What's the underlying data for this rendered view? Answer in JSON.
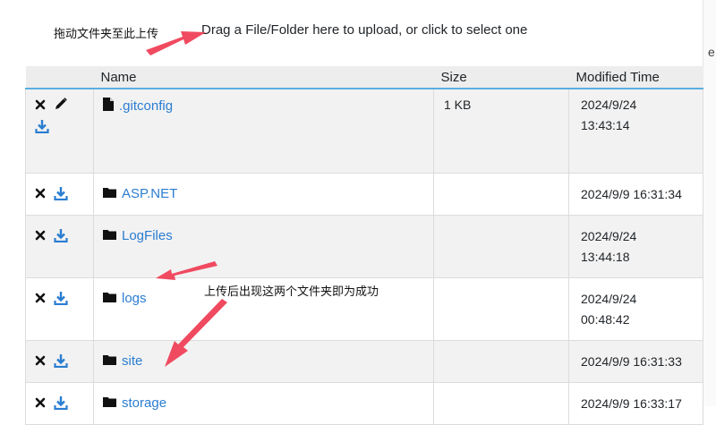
{
  "annotations": {
    "drag_hint_cn": "拖动文件夹至此上传",
    "result_hint_cn": "上传后出现这两个文件夹即为成功"
  },
  "upload_hint": "Drag a File/Folder here to upload, or click to select one",
  "side_letter": "e",
  "table": {
    "headers": {
      "name": "Name",
      "size": "Size",
      "modified": "Modified Time"
    },
    "rows": [
      {
        "type": "file",
        "name": ".gitconfig",
        "size": "1 KB",
        "modified_date": "2024/9/24",
        "modified_time": "13:43:14",
        "editable": true
      },
      {
        "type": "folder",
        "name": "ASP.NET",
        "size": "",
        "modified_date": "2024/9/9 16:31:34",
        "modified_time": "",
        "editable": false
      },
      {
        "type": "folder",
        "name": "LogFiles",
        "size": "",
        "modified_date": "2024/9/24",
        "modified_time": "13:44:18",
        "editable": false
      },
      {
        "type": "folder",
        "name": "logs",
        "size": "",
        "modified_date": "2024/9/24",
        "modified_time": "00:48:42",
        "editable": false
      },
      {
        "type": "folder",
        "name": "site",
        "size": "",
        "modified_date": "2024/9/9 16:31:33",
        "modified_time": "",
        "editable": false
      },
      {
        "type": "folder",
        "name": "storage",
        "size": "",
        "modified_date": "2024/9/9 16:33:17",
        "modified_time": "",
        "editable": false
      }
    ]
  },
  "colors": {
    "link": "#2a7dd1",
    "header_rule": "#5aaee0",
    "arrow": "#f04a60"
  }
}
